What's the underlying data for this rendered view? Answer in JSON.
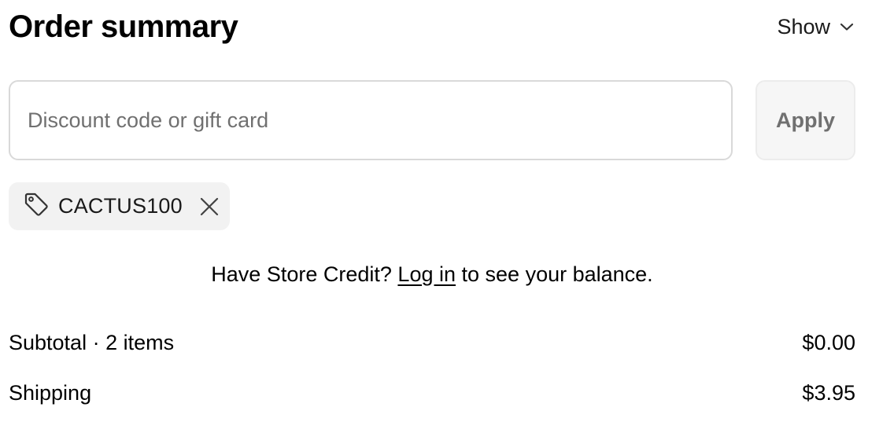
{
  "header": {
    "title": "Order summary",
    "toggle_label": "Show",
    "toggle_icon": "chevron-down-icon"
  },
  "discount": {
    "placeholder": "Discount code or gift card",
    "value": "",
    "apply_label": "Apply"
  },
  "applied_code": {
    "icon": "tag-icon",
    "code": "CACTUS100",
    "remove_icon": "close-icon"
  },
  "store_credit": {
    "prefix": "Have Store Credit?",
    "link_label": "Log in",
    "suffix": "to see your balance."
  },
  "summary_lines": {
    "subtotal": {
      "label": "Subtotal · 2 items",
      "amount": "$0.00"
    },
    "shipping": {
      "label": "Shipping",
      "amount": "$3.95"
    }
  },
  "colors": {
    "input_border": "#d9d9d9",
    "apply_bg": "#f6f6f6",
    "apply_text": "#707070",
    "chip_bg": "#f2f2f2"
  }
}
